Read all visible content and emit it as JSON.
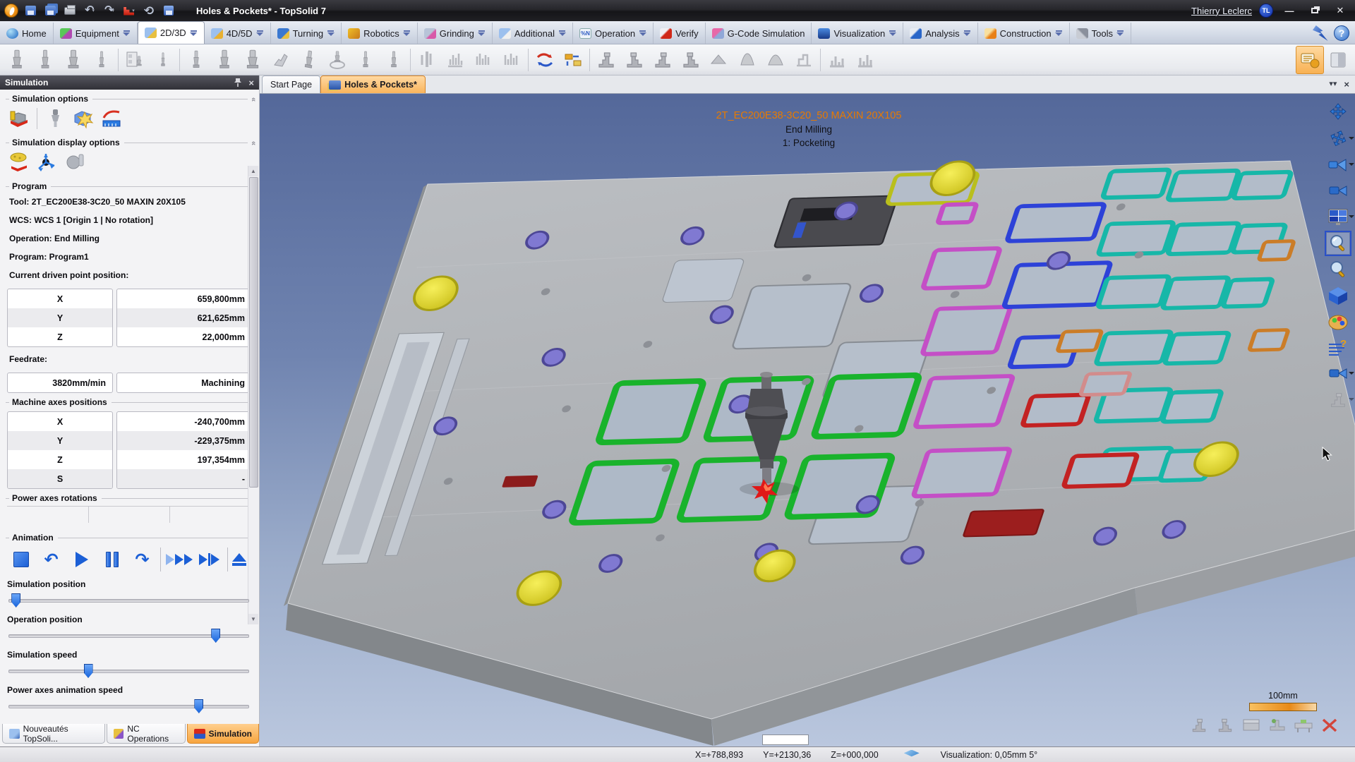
{
  "title_bar": {
    "title": "Holes & Pockets* - TopSolid 7",
    "user": "Thierry Leclerc",
    "user_badge": "TL"
  },
  "ribbon": {
    "tabs": [
      {
        "label": "Home"
      },
      {
        "label": "Equipment"
      },
      {
        "label": "2D/3D"
      },
      {
        "label": "4D/5D"
      },
      {
        "label": "Turning"
      },
      {
        "label": "Robotics"
      },
      {
        "label": "Grinding"
      },
      {
        "label": "Additional"
      },
      {
        "label": "Operation"
      },
      {
        "label": "Verify"
      },
      {
        "label": "G-Code Simulation"
      },
      {
        "label": "Visualization"
      },
      {
        "label": "Analysis"
      },
      {
        "label": "Construction"
      },
      {
        "label": "Tools"
      }
    ]
  },
  "doc_tabs": [
    {
      "label": "Start Page"
    },
    {
      "label": "Holes & Pockets*"
    }
  ],
  "panel": {
    "title": "Simulation",
    "groups": {
      "options_label": "Simulation options",
      "display_label": "Simulation display options",
      "program_label": "Program",
      "machine_axes_label": "Machine axes positions",
      "power_axes_label": "Power axes rotations",
      "animation_label": "Animation"
    },
    "program": {
      "tool": "Tool: 2T_EC200E38-3C20_50 MAXIN 20X105",
      "wcs": "WCS: WCS 1 [Origin 1 | No rotation]",
      "operation": "Operation: End Milling",
      "program": "Program: Program1",
      "driven_point_label": "Current driven point position:"
    },
    "driven_point": [
      {
        "axis": "X",
        "value": "659,800mm"
      },
      {
        "axis": "Y",
        "value": "621,625mm"
      },
      {
        "axis": "Z",
        "value": "22,000mm"
      }
    ],
    "feedrate_label": "Feedrate:",
    "feedrate": {
      "value": "3820mm/min",
      "mode": "Machining"
    },
    "machine_axes": [
      {
        "axis": "X",
        "value": "-240,700mm"
      },
      {
        "axis": "Y",
        "value": "-229,375mm"
      },
      {
        "axis": "Z",
        "value": "197,354mm"
      },
      {
        "axis": "S",
        "value": "-"
      }
    ],
    "sliders": [
      {
        "label": "Simulation position",
        "pos": 3
      },
      {
        "label": "Operation position",
        "pos": 86
      },
      {
        "label": "Simulation speed",
        "pos": 33
      },
      {
        "label": "Power axes animation speed",
        "pos": 79
      }
    ]
  },
  "bottom_tabs": [
    {
      "label": "Nouveautés TopSoli..."
    },
    {
      "label": "NC Operations"
    },
    {
      "label": "Simulation"
    }
  ],
  "viewport": {
    "tool_title": "2T_EC200E38-3C20_50 MAXIN 20X105",
    "operation": "End Milling",
    "step": "1: Pocketing",
    "scale_label": "100mm"
  },
  "status_bar": {
    "x": "X=+788,893",
    "y": "Y=+2130,36",
    "z": "Z=+000,000",
    "visualization": "Visualization: 0,05mm 5°"
  },
  "colors": {
    "accent_orange": "#f7a53f",
    "overlay_title_orange": "#e87a00",
    "animation_blue": "#1b5fd6",
    "viewport_top": "#54689a",
    "viewport_bottom": "#bac7de"
  }
}
